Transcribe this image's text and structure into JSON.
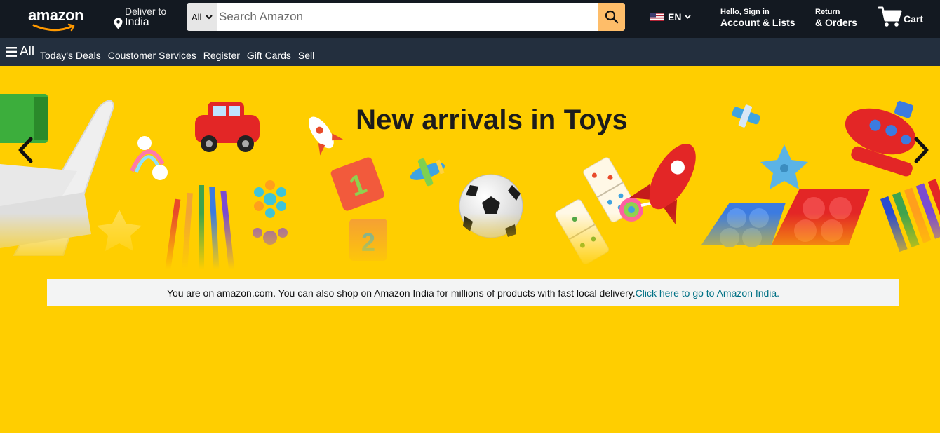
{
  "header": {
    "logo_text": "amazon",
    "deliver": {
      "line1": "Deliver to",
      "line2": "India"
    },
    "search": {
      "category": "All",
      "placeholder": "Search Amazon",
      "value": ""
    },
    "language": {
      "code": "EN",
      "flag_icon": "us-flag-icon"
    },
    "account": {
      "line1": "Hello, Sign in",
      "line2": "Account & Lists"
    },
    "orders": {
      "line1": "Return",
      "line2": "& Orders"
    },
    "cart": {
      "label": "Cart",
      "icon": "cart-icon"
    }
  },
  "nav": {
    "all_label": "All",
    "links": [
      "Today's Deals",
      "Coustomer Services",
      "Register",
      "Gift Cards",
      "Sell"
    ]
  },
  "hero": {
    "title": "New arrivals in Toys",
    "left_arrow_icon": "chevron-left-icon",
    "right_arrow_icon": "chevron-right-icon"
  },
  "notice": {
    "text": "You are on amazon.com. You can also shop on Amazon India for millions of products with fast local delivery.",
    "link": "Click here to go to Amazon India."
  },
  "colors": {
    "header_bg": "#131921",
    "nav_bg": "#232f3e",
    "search_button": "#febd69",
    "hero_bg": "#ffce00",
    "notice_bg": "#f3f4f4",
    "link": "#007185"
  }
}
